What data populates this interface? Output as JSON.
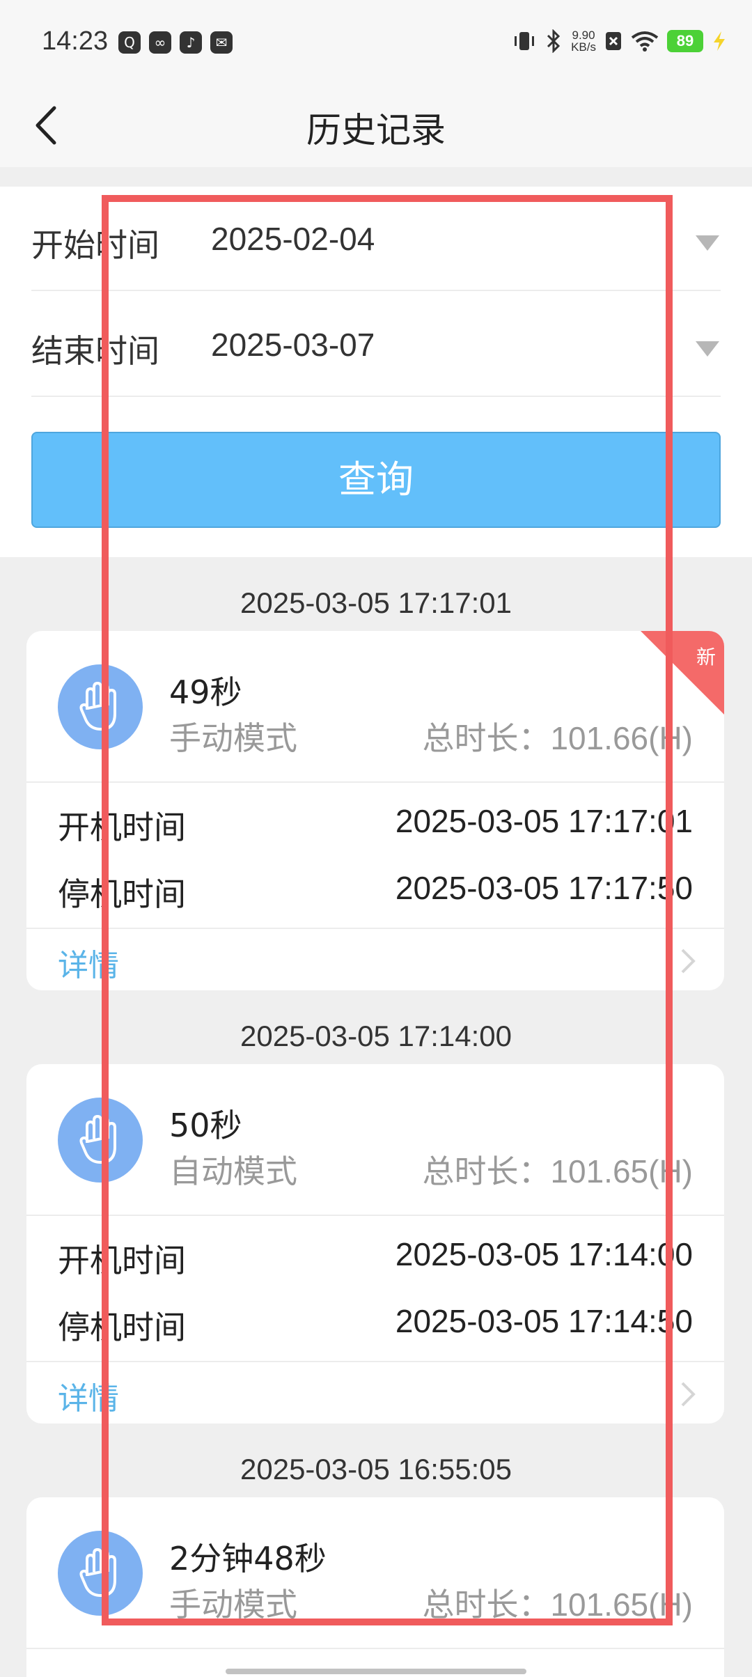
{
  "status_bar": {
    "time": "14:23",
    "left_icons": [
      "qq-icon",
      "link-icon",
      "tiktok-icon",
      "mail-icon"
    ],
    "net_speed_value": "9.90",
    "net_speed_unit": "KB/s",
    "battery": "89"
  },
  "nav": {
    "title": "历史记录"
  },
  "filter": {
    "start_label": "开始时间",
    "start_value": "2025-02-04",
    "end_label": "结束时间",
    "end_value": "2025-03-07",
    "query_label": "查询"
  },
  "records": [
    {
      "group_date": "2025-03-05 17:17:01",
      "duration": "49秒",
      "mode": "手动模式",
      "total": "总时长：101.66(H)",
      "new_badge": "新",
      "start_label": "开机时间",
      "start_time": "2025-03-05 17:17:01",
      "stop_label": "停机时间",
      "stop_time": "2025-03-05 17:17:50",
      "details": "详情"
    },
    {
      "group_date": "2025-03-05 17:14:00",
      "duration": "50秒",
      "mode": "自动模式",
      "total": "总时长：101.65(H)",
      "start_label": "开机时间",
      "start_time": "2025-03-05 17:14:00",
      "stop_label": "停机时间",
      "stop_time": "2025-03-05 17:14:50",
      "details": "详情"
    },
    {
      "group_date": "2025-03-05 16:55:05",
      "duration": "2分钟48秒",
      "mode": "手动模式",
      "total": "总时长：101.65(H)"
    }
  ],
  "colors": {
    "accent": "#62bffa",
    "highlight": "#f05b5c",
    "new_badge": "#f46a69",
    "link": "#5ab4e8",
    "mode_icon_bg": "#7fb1f2"
  }
}
